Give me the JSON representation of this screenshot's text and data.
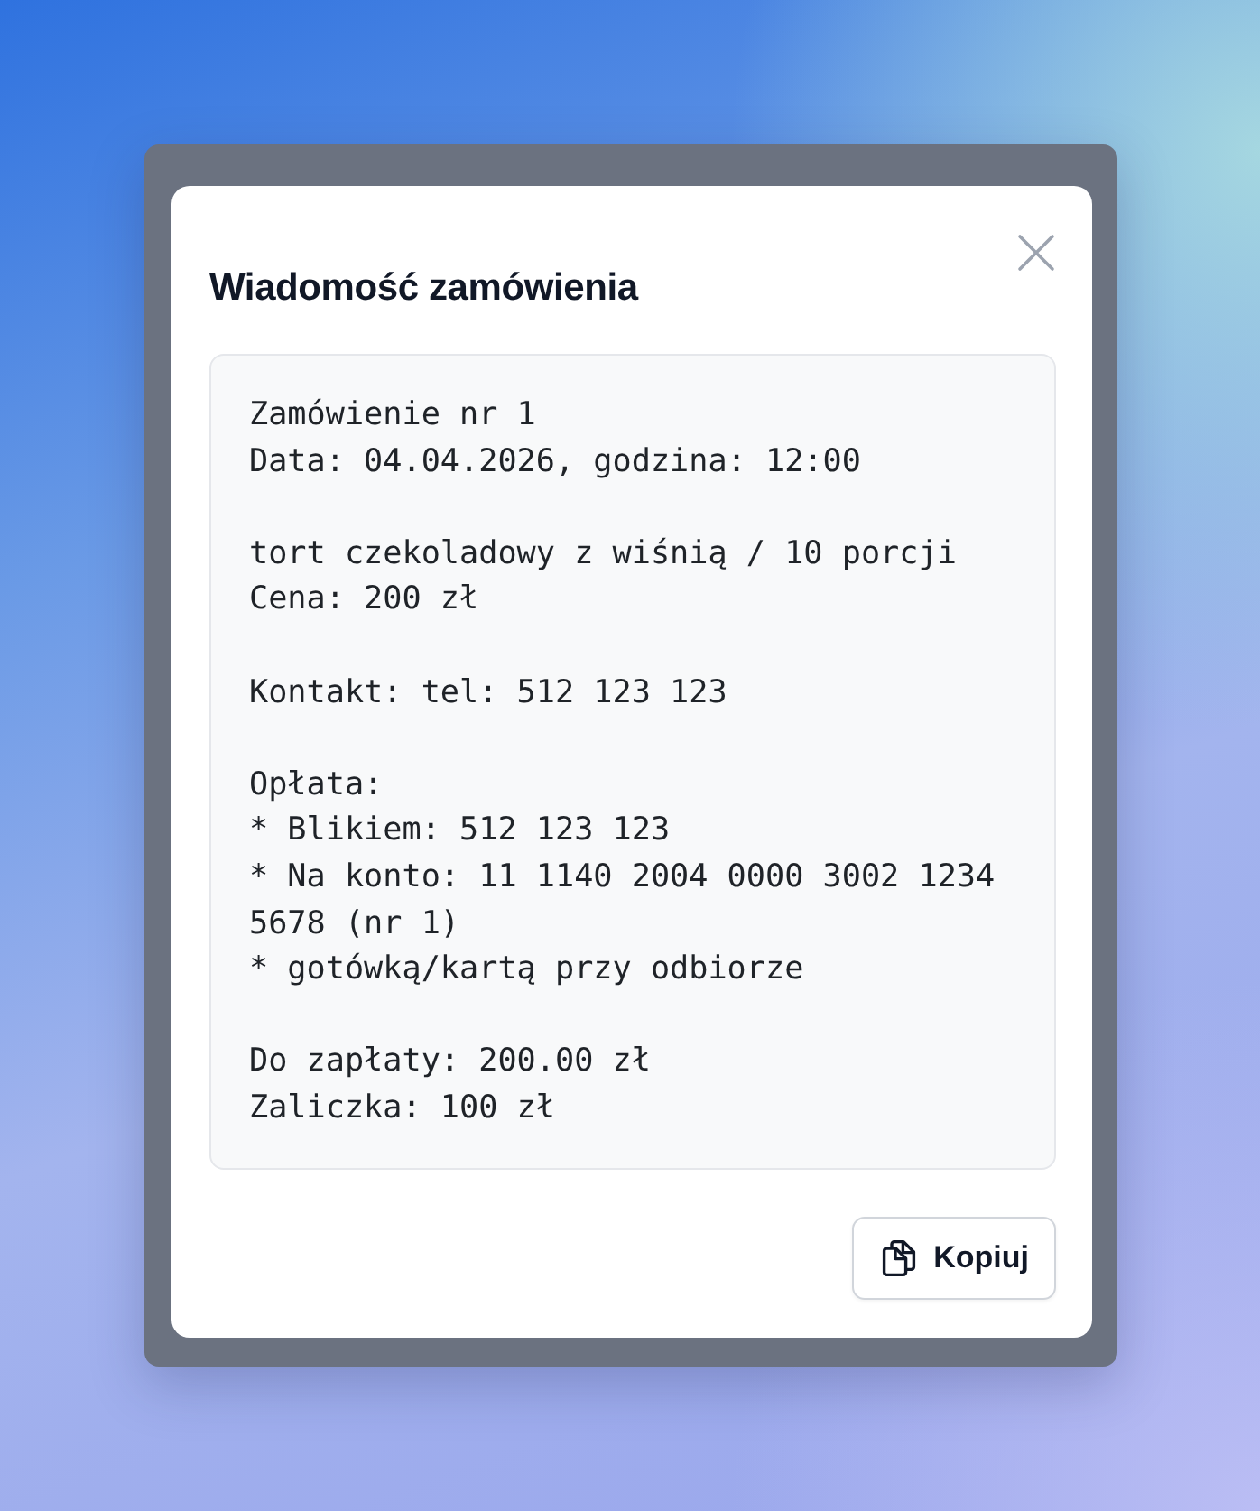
{
  "dialog": {
    "title": "Wiadomość zamówienia",
    "message": {
      "paragraphs": [
        [
          "Zamówienie nr 1",
          "Data: 04.04.2026, godzina: 12:00"
        ],
        [
          "tort czekoladowy z wiśnią / 10 porcji",
          "Cena: 200 zł"
        ],
        [
          "Kontakt: tel: 512 123 123"
        ],
        [
          "Opłata:",
          "* Blikiem: 512 123 123",
          "* Na konto: 11 1140 2004 0000 3002 1234 5678 (nr 1)",
          "* gotówką/kartą przy odbiorze"
        ],
        [
          "Do zapłaty: 200.00 zł",
          "Zaliczka: 100 zł"
        ]
      ]
    },
    "copy_button": {
      "label": "Kopiuj"
    }
  }
}
